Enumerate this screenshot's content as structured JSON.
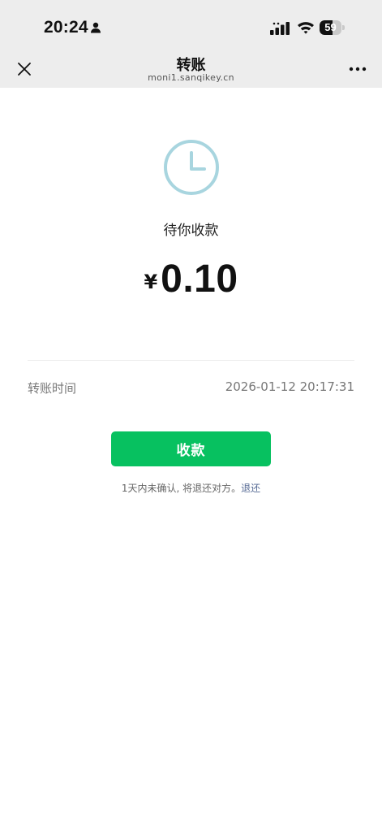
{
  "status_bar": {
    "time": "20:24",
    "battery_percent": "59",
    "battery_level": 0.59,
    "icons": [
      "person-icon",
      "signal-icon",
      "wifi-icon",
      "battery-icon"
    ]
  },
  "nav": {
    "title": "转账",
    "subtitle": "moni1.sanqikey.cn",
    "close_icon": "close-icon",
    "more_icon": "more-icon"
  },
  "transfer": {
    "status_icon": "clock-icon",
    "status": "待你收款",
    "currency_symbol": "¥",
    "amount": "0.10",
    "info_label": "转账时间",
    "info_value": "2026-01-12 20:17:31"
  },
  "actions": {
    "receive_label": "收款",
    "note_text": "1天内未确认, 将退还对方。",
    "refund_link": "退还"
  },
  "colors": {
    "accent_green": "#07c160",
    "link_blue": "#576b95",
    "clock_teal": "#a8d5df",
    "header_bg": "#ededed"
  }
}
